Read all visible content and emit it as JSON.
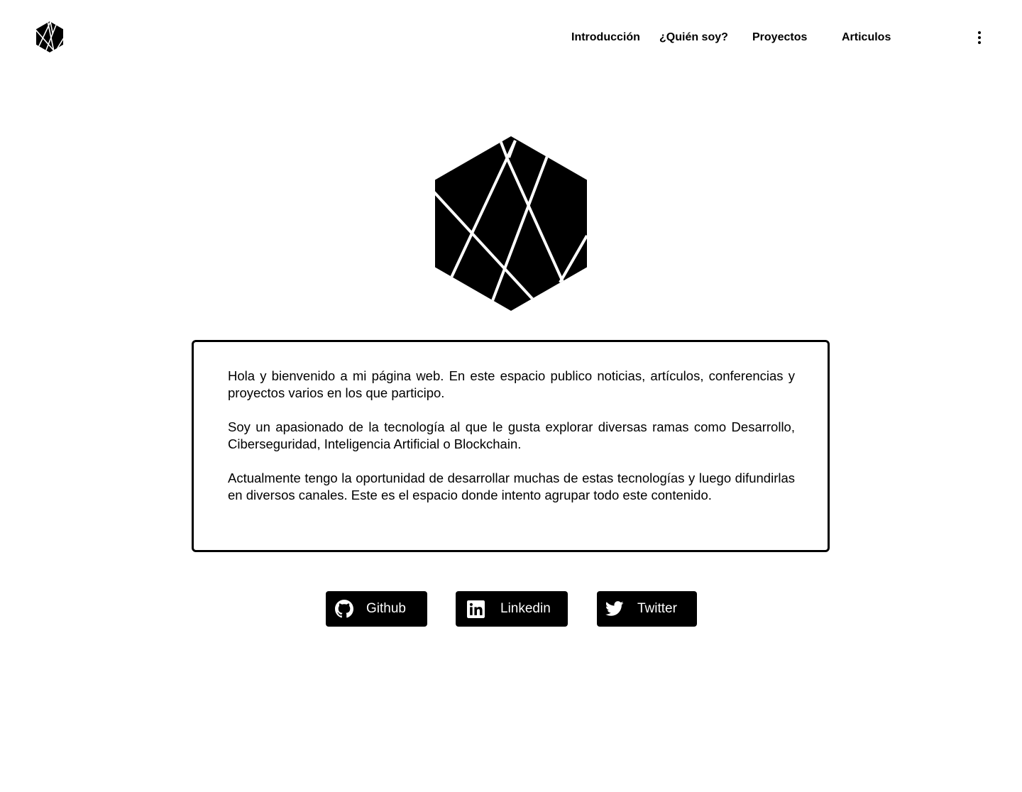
{
  "header": {
    "logo_icon": "hexagon-logo-icon",
    "nav": [
      {
        "label": "Introducción"
      },
      {
        "label": "¿Quién soy?"
      },
      {
        "label": "Proyectos"
      },
      {
        "label": "Articulos"
      }
    ],
    "menu_icon": "kebab-menu-icon"
  },
  "hero": {
    "logo_icon": "hexagon-logo-icon"
  },
  "intro": {
    "paragraphs": [
      "Hola y bienvenido a mi página web. En este espacio publico noticias, artículos, conferencias y proyectos varios en los que participo.",
      "Soy un apasionado de la tecnología al que le gusta explorar diversas ramas como Desarrollo, Ciberseguridad, Inteligencia Artificial o Blockchain.",
      "Actualmente tengo la oportunidad de desarrollar muchas de estas tecnologías y luego difundirlas en diversos canales. Este es el espacio donde intento agrupar todo este contenido."
    ]
  },
  "social": [
    {
      "label": "Github",
      "icon": "github-icon"
    },
    {
      "label": "Linkedin",
      "icon": "linkedin-icon"
    },
    {
      "label": "Twitter",
      "icon": "twitter-icon"
    }
  ],
  "colors": {
    "background": "#ffffff",
    "foreground": "#000000",
    "button_text": "#ffffff"
  }
}
